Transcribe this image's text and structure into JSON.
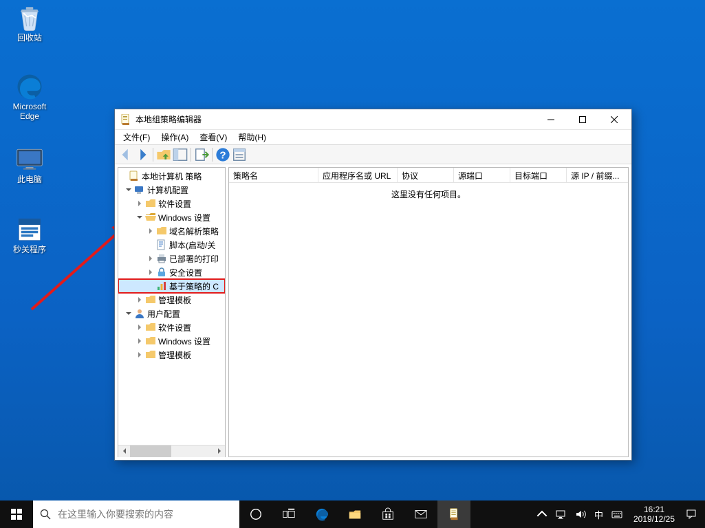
{
  "desktop": {
    "recycle_bin": "回收站",
    "edge_l1": "Microsoft",
    "edge_l2": "Edge",
    "this_pc": "此电脑",
    "shutdown_app": "秒关程序"
  },
  "window": {
    "title": "本地组策略编辑器",
    "menu": {
      "file": "文件(F)",
      "action": "操作(A)",
      "view": "查看(V)",
      "help": "帮助(H)"
    },
    "tree": {
      "root": "本地计算机 策略",
      "computer_cfg": "计算机配置",
      "soft_settings": "软件设置",
      "win_settings": "Windows 设置",
      "dns_policy": "域名解析策略",
      "scripts": "脚本(启动/关",
      "printers": "已部署的打印",
      "security": "安全设置",
      "qos": "基于策略的 C",
      "admin_tmpl": "管理模板",
      "user_cfg": "用户配置",
      "u_soft": "软件设置",
      "u_win": "Windows 设置",
      "u_admin": "管理模板"
    },
    "columns": {
      "c0": "策略名",
      "c1": "应用程序名或 URL",
      "c2": "协议",
      "c3": "源端口",
      "c4": "目标端口",
      "c5": "源 IP / 前缀..."
    },
    "empty": "这里没有任何项目。"
  },
  "taskbar": {
    "search_placeholder": "在这里输入你要搜索的内容",
    "ime": "中",
    "time": "16:21",
    "date": "2019/12/25"
  }
}
